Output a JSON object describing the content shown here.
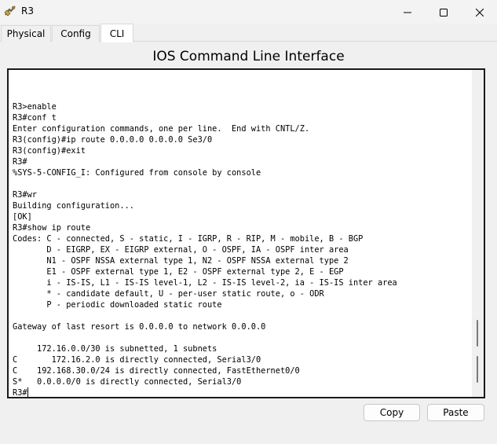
{
  "window": {
    "title": "R3",
    "app_icon": "router-icon",
    "controls": [
      "minimize-icon",
      "maximize-icon",
      "close-icon"
    ]
  },
  "tabs": [
    {
      "label": "Physical",
      "active": false
    },
    {
      "label": "Config",
      "active": false
    },
    {
      "label": "CLI",
      "active": true
    }
  ],
  "heading": "IOS Command Line Interface",
  "console": {
    "lines": [
      "R3>enable",
      "R3#conf t",
      "Enter configuration commands, one per line.  End with CNTL/Z.",
      "R3(config)#ip route 0.0.0.0 0.0.0.0 Se3/0",
      "R3(config)#exit",
      "R3#",
      "%SYS-5-CONFIG_I: Configured from console by console",
      "",
      "R3#wr",
      "Building configuration...",
      "[OK]",
      "R3#show ip route",
      "Codes: C - connected, S - static, I - IGRP, R - RIP, M - mobile, B - BGP",
      "       D - EIGRP, EX - EIGRP external, O - OSPF, IA - OSPF inter area",
      "       N1 - OSPF NSSA external type 1, N2 - OSPF NSSA external type 2",
      "       E1 - OSPF external type 1, E2 - OSPF external type 2, E - EGP",
      "       i - IS-IS, L1 - IS-IS level-1, L2 - IS-IS level-2, ia - IS-IS inter area",
      "       * - candidate default, U - per-user static route, o - ODR",
      "       P - periodic downloaded static route",
      "",
      "Gateway of last resort is 0.0.0.0 to network 0.0.0.0",
      "",
      "     172.16.0.0/30 is subnetted, 1 subnets",
      "C       172.16.2.0 is directly connected, Serial3/0",
      "C    192.168.30.0/24 is directly connected, FastEthernet0/0",
      "S*   0.0.0.0/0 is directly connected, Serial3/0"
    ],
    "prompt": "R3#"
  },
  "buttons": {
    "copy": "Copy",
    "paste": "Paste"
  },
  "colors": {
    "window_bg": "#f0f0f0",
    "console_bg": "#ffffff",
    "console_border": "#1a1a1a",
    "text": "#000000"
  }
}
